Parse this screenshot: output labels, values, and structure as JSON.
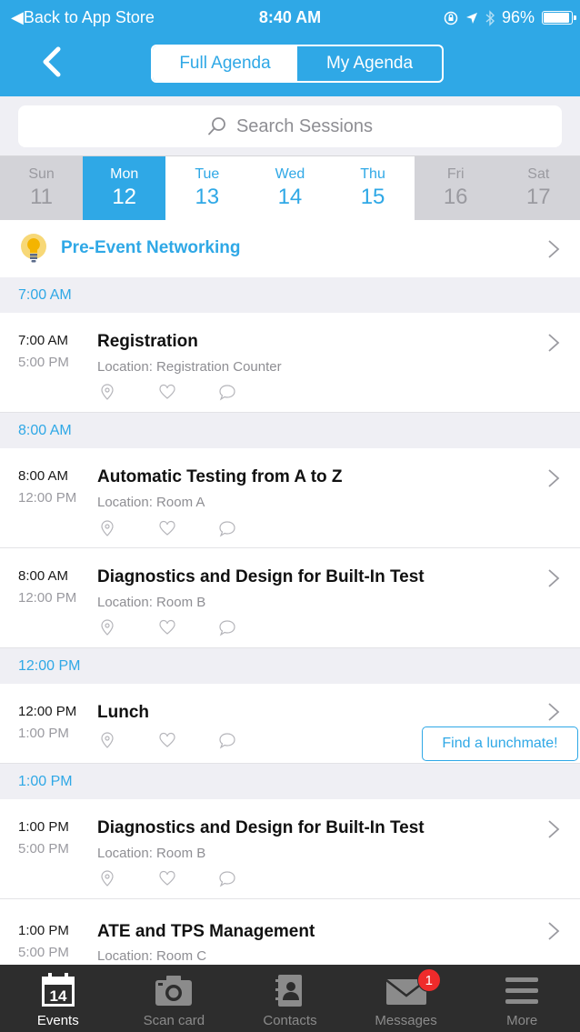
{
  "status_bar": {
    "back_label": "◀Back to App Store",
    "time": "8:40 AM",
    "battery": "96%"
  },
  "nav": {
    "tabs": [
      {
        "label": "Full Agenda",
        "selected": true
      },
      {
        "label": "My Agenda",
        "selected": false
      }
    ]
  },
  "search": {
    "placeholder": "Search Sessions"
  },
  "days": [
    {
      "name": "Sun",
      "date": "11",
      "state": "off"
    },
    {
      "name": "Mon",
      "date": "12",
      "state": "selected"
    },
    {
      "name": "Tue",
      "date": "13",
      "state": "on"
    },
    {
      "name": "Wed",
      "date": "14",
      "state": "on"
    },
    {
      "name": "Thu",
      "date": "15",
      "state": "on"
    },
    {
      "name": "Fri",
      "date": "16",
      "state": "off"
    },
    {
      "name": "Sat",
      "date": "17",
      "state": "off"
    }
  ],
  "pre_event": {
    "label": "Pre-Event Networking"
  },
  "sections": [
    {
      "header": "7:00 AM"
    },
    {
      "header": "8:00 AM"
    },
    {
      "header": "12:00 PM"
    },
    {
      "header": "1:00 PM"
    }
  ],
  "sessions": [
    {
      "start": "7:00 AM",
      "end": "5:00 PM",
      "title": "Registration",
      "location": "Location: Registration Counter"
    },
    {
      "start": "8:00 AM",
      "end": "12:00 PM",
      "title": "Automatic Testing from A to Z",
      "location": "Location: Room A"
    },
    {
      "start": "8:00 AM",
      "end": "12:00 PM",
      "title": "Diagnostics and Design for Built-In Test",
      "location": "Location: Room B"
    },
    {
      "start": "12:00 PM",
      "end": "1:00 PM",
      "title": "Lunch",
      "location": "",
      "action": "Find a lunchmate!"
    },
    {
      "start": "1:00 PM",
      "end": "5:00 PM",
      "title": "Diagnostics and Design for Built-In Test",
      "location": "Location: Room B"
    },
    {
      "start": "1:00 PM",
      "end": "5:00 PM",
      "title": "ATE and TPS Management",
      "location": "Location: Room C"
    }
  ],
  "tabbar": {
    "items": [
      {
        "label": "Events",
        "icon": "calendar-icon",
        "calendar_day": "14",
        "active": true
      },
      {
        "label": "Scan card",
        "icon": "camera-icon"
      },
      {
        "label": "Contacts",
        "icon": "contacts-icon"
      },
      {
        "label": "Messages",
        "icon": "envelope-icon",
        "badge": "1"
      },
      {
        "label": "More",
        "icon": "menu-icon"
      }
    ]
  },
  "colors": {
    "accent": "#2fa8e6",
    "tabbar_bg": "#2d2d2d",
    "badge": "#ef2b2b"
  }
}
